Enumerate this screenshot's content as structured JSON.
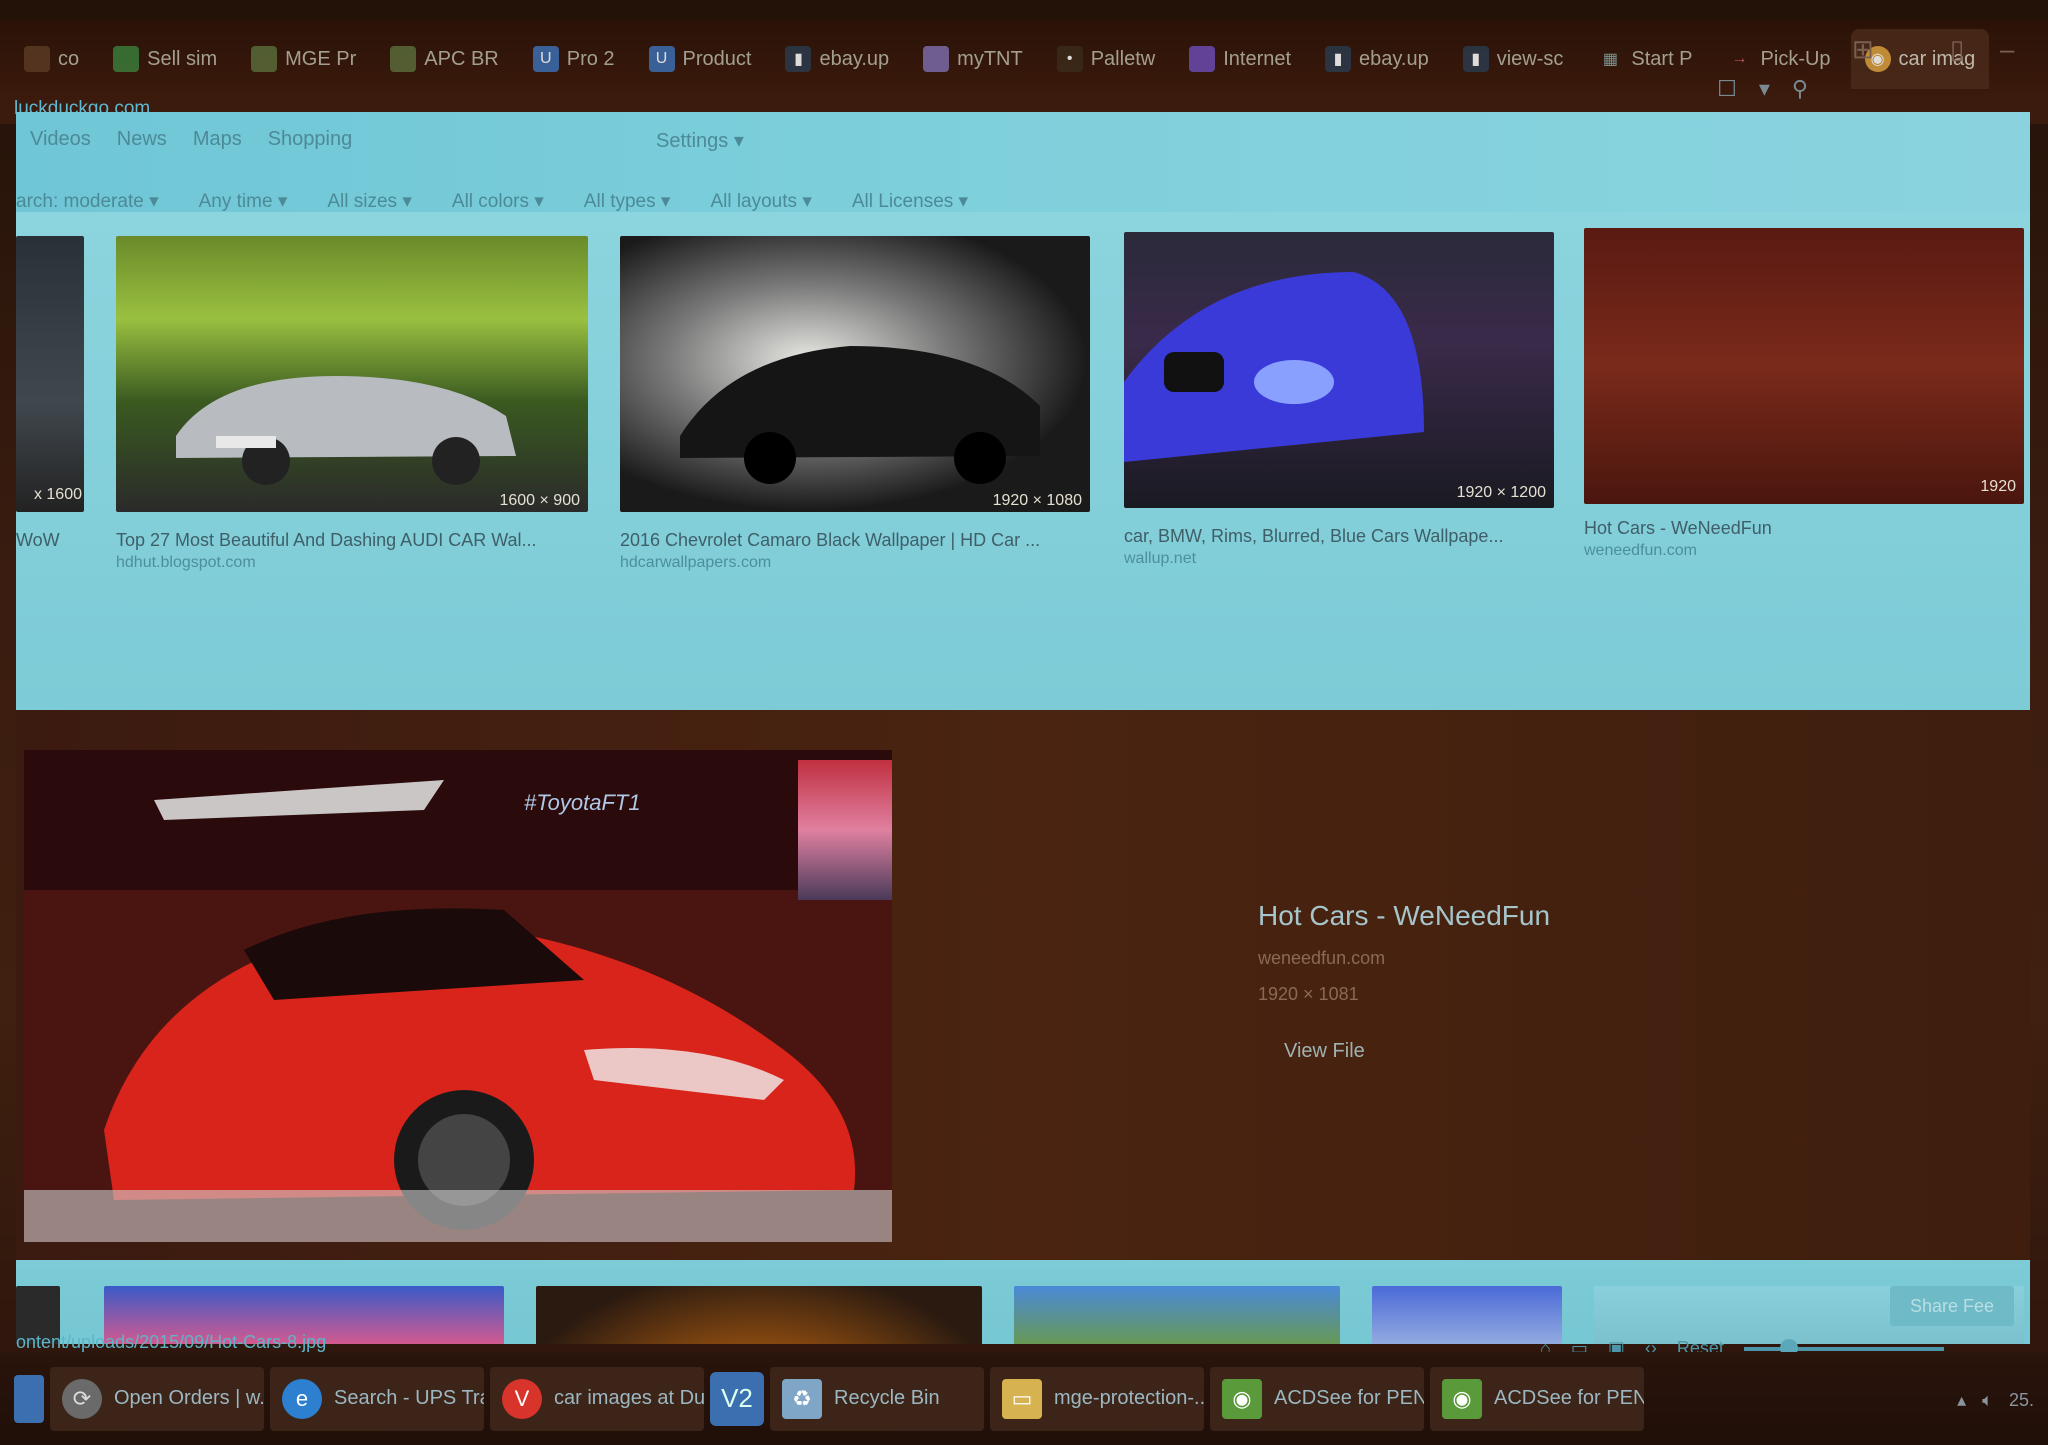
{
  "tabs": [
    {
      "label": "co",
      "icon": "tab-icon"
    },
    {
      "label": "Sell sim",
      "icon": "tab-icon"
    },
    {
      "label": "MGE Pr",
      "icon": "tab-icon"
    },
    {
      "label": "APC BR",
      "icon": "tab-icon"
    },
    {
      "label": "Pro 2",
      "icon": "u-icon"
    },
    {
      "label": "Product",
      "icon": "u-icon"
    },
    {
      "label": "ebay.up",
      "icon": "doc-icon"
    },
    {
      "label": "myTNT",
      "icon": "tab-icon"
    },
    {
      "label": "Palletw",
      "icon": "tab-icon"
    },
    {
      "label": "Internet",
      "icon": "tab-icon"
    },
    {
      "label": "ebay.up",
      "icon": "doc-icon"
    },
    {
      "label": "view-sc",
      "icon": "doc-icon"
    },
    {
      "label": "Start P",
      "icon": "grid-icon"
    },
    {
      "label": "Pick-Up",
      "icon": "tab-icon"
    },
    {
      "label": "car imag",
      "icon": "duckduckgo-icon"
    }
  ],
  "address": "luckduckgo.com",
  "nav": [
    "Videos",
    "News",
    "Maps",
    "Shopping"
  ],
  "settings": "Settings",
  "filters": [
    "arch: moderate",
    "Any time",
    "All sizes",
    "All colors",
    "All types",
    "All layouts",
    "All Licenses"
  ],
  "results": [
    {
      "caption": "WoW",
      "source": "",
      "dims": "x 1600"
    },
    {
      "caption": "Top 27 Most Beautiful And Dashing AUDI CAR Wal...",
      "source": "hdhut.blogspot.com",
      "dims": "1600 × 900"
    },
    {
      "caption": "2016 Chevrolet Camaro Black Wallpaper | HD Car ...",
      "source": "hdcarwallpapers.com",
      "dims": "1920 × 1080"
    },
    {
      "caption": "car, BMW, Rims, Blurred, Blue Cars Wallpape...",
      "source": "wallup.net",
      "dims": "1920 × 1200"
    },
    {
      "caption": "Hot Cars - WeNeedFun",
      "source": "weneedfun.com",
      "dims": "1920"
    }
  ],
  "detail": {
    "title": "Hot Cars - WeNeedFun",
    "source": "weneedfun.com",
    "dims": "1920 × 1081",
    "view": "View File",
    "hero_tag": "#ToyotaFT1"
  },
  "share": "Share Fee",
  "status_url": "ontent/uploads/2015/09/Hot-Cars-8.jpg",
  "zoom_reset": "Reset",
  "taskbar": [
    {
      "label": "Open Orders | w...",
      "icon": "refresh-icon",
      "color": "#6a6a6a"
    },
    {
      "label": "Search - UPS Tra...",
      "icon": "edge-icon",
      "color": "#2d7fd0"
    },
    {
      "label": "car images at Du...",
      "icon": "vivaldi-icon",
      "color": "#d8342c"
    },
    {
      "label": "Recycle Bin",
      "icon": "recycle-bin-icon",
      "color": "#7fa6c6"
    },
    {
      "label": "mge-protection-...",
      "icon": "folder-icon",
      "color": "#d6b350"
    },
    {
      "label": "ACDSee for PENT...",
      "icon": "acdsee-icon",
      "color": "#5a9a3a"
    },
    {
      "label": "ACDSee for PENT...",
      "icon": "acdsee-icon",
      "color": "#5a9a3a"
    }
  ],
  "clock": "25."
}
